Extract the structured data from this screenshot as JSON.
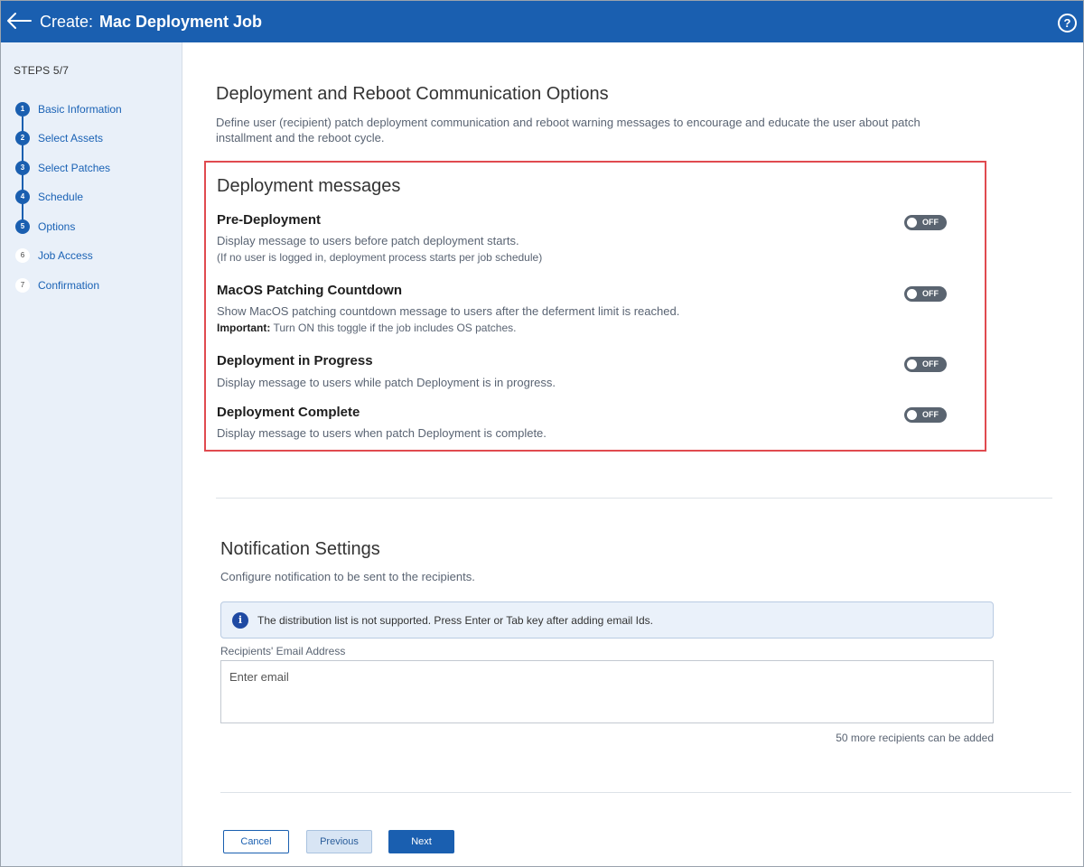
{
  "header": {
    "title_prefix": "Create:",
    "title_main": "Mac Deployment Job",
    "help_glyph": "?"
  },
  "sidebar": {
    "steps_label": "STEPS 5/7",
    "steps": [
      {
        "num": "1",
        "label": "Basic Information",
        "state": "completed"
      },
      {
        "num": "2",
        "label": "Select Assets",
        "state": "completed"
      },
      {
        "num": "3",
        "label": "Select Patches",
        "state": "completed"
      },
      {
        "num": "4",
        "label": "Schedule",
        "state": "completed"
      },
      {
        "num": "5",
        "label": "Options",
        "state": "current"
      },
      {
        "num": "6",
        "label": "Job Access",
        "state": "pending"
      },
      {
        "num": "7",
        "label": "Confirmation",
        "state": "pending"
      }
    ]
  },
  "communication": {
    "title": "Deployment and Reboot Communication Options",
    "description": "Define user (recipient) patch deployment communication and reboot warning messages to encourage and educate the user about patch installment and the reboot cycle."
  },
  "deployment_messages": {
    "title": "Deployment messages",
    "options": [
      {
        "title": "Pre-Deployment",
        "description": "Display message to users before patch deployment starts.",
        "note": "(If no user is logged in, deployment process starts per job schedule)",
        "toggle": "OFF"
      },
      {
        "title": "MacOS Patching Countdown",
        "description": "Show MacOS patching countdown message to users after the deferment limit is reached.",
        "note_label": "Important:",
        "note": "Turn ON this toggle if the job includes OS patches.",
        "toggle": "OFF"
      },
      {
        "title": "Deployment in Progress",
        "description": "Display message to users while patch Deployment is in progress.",
        "toggle": "OFF"
      },
      {
        "title": "Deployment Complete",
        "description": "Display message to users when patch Deployment is complete.",
        "toggle": "OFF"
      }
    ]
  },
  "notification": {
    "title": "Notification Settings",
    "description": "Configure notification to be sent to the recipients.",
    "info_icon": "i",
    "info": "The distribution list is not supported. Press Enter or Tab key after adding email Ids.",
    "email_label": "Recipients' Email Address",
    "email_placeholder": "Enter email",
    "email_value": "",
    "recipients_note": "50 more recipients can be added"
  },
  "footer": {
    "cancel": "Cancel",
    "previous": "Previous",
    "next": "Next"
  },
  "colors": {
    "header_bg": "#1a5fb0",
    "sidebar_bg": "#e9f0f9",
    "highlight_border": "#e04a4f",
    "toggle_off": "#5a6470"
  }
}
